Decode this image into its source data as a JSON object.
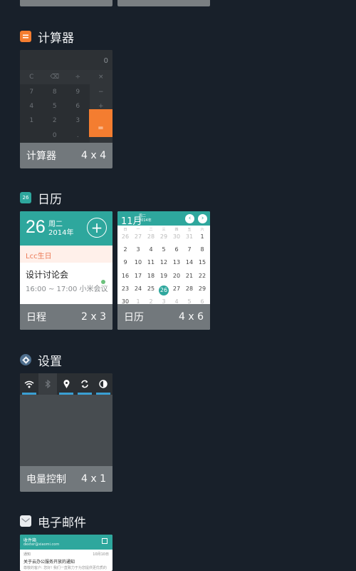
{
  "colors": {
    "background": "#18202a",
    "teal": "#2ea79d",
    "orange": "#f47d30",
    "blue": "#3a9fd3"
  },
  "sections": [
    {
      "title": "计算器",
      "icon": "calculator-icon"
    },
    {
      "title": "日历",
      "icon": "calendar-icon"
    },
    {
      "title": "设置",
      "icon": "settings-gear-icon"
    },
    {
      "title": "电子邮件",
      "icon": "mail-icon"
    }
  ],
  "calculator": {
    "display_value": "0",
    "keys": [
      "C",
      "⌫",
      "÷",
      "×",
      "7",
      "8",
      "9",
      "−",
      "4",
      "5",
      "6",
      "+",
      "1",
      "2",
      "3",
      "",
      "",
      "0",
      ".",
      ""
    ],
    "equals": "=",
    "name": "计算器",
    "size": "4 x 4"
  },
  "agenda": {
    "day": "26",
    "weekday": "周二",
    "year": "2014年",
    "add_symbol": "+",
    "birthday": "Lcc生日",
    "event_title": "设计讨论会",
    "event_time": "16:00 ~ 17:00   小米会议",
    "name": "日程",
    "size": "2 x 3"
  },
  "month_calendar": {
    "month": "11月",
    "weekday_year": "周二",
    "year_small": "2014年",
    "prev": "‹",
    "next": "›",
    "weekdays": [
      "日",
      "一",
      "二",
      "三",
      "四",
      "五",
      "六"
    ],
    "today": "26",
    "name": "日历",
    "size": "4 x 6"
  },
  "power": {
    "name": "电量控制",
    "size": "4 x 1"
  },
  "email": {
    "inbox": "收件箱",
    "account": "dexter@xiaomi.com",
    "from": "通知",
    "date": "10月10日",
    "subject": "关于云办公服务开放的通知",
    "snippet": "尊敬的客户: 您好! 我们一直致力于为您提供更优质的"
  }
}
